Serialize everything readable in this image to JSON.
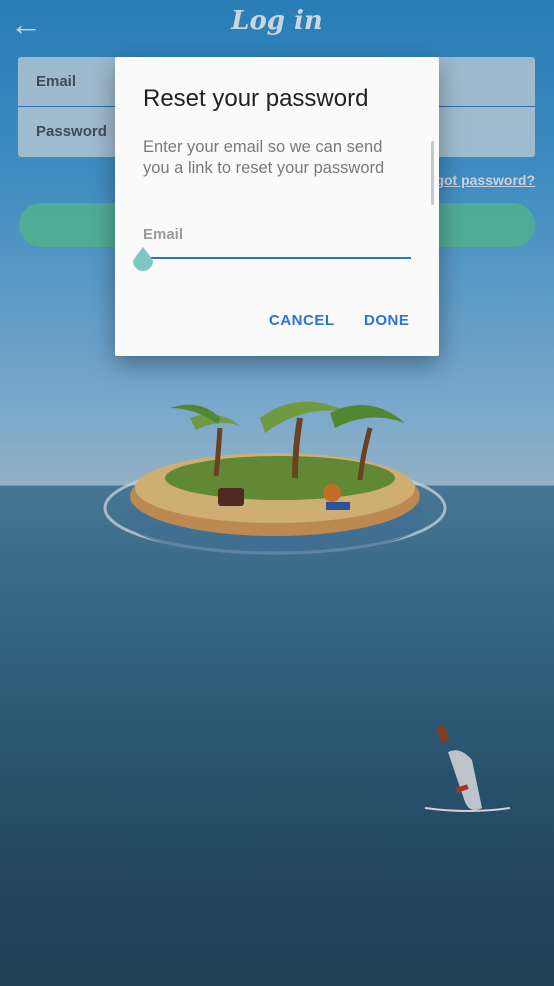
{
  "header": {
    "title": "Log in",
    "back_icon": "arrow-left-icon"
  },
  "form": {
    "email_placeholder": "Email",
    "password_placeholder": "Password",
    "forgot_link": "got password?"
  },
  "dialog": {
    "title": "Reset your password",
    "message": "Enter your email so we can send you a link to reset your password",
    "email_label": "Email",
    "email_value": "",
    "cancel_label": "CANCEL",
    "done_label": "DONE"
  },
  "colors": {
    "accent": "#2e72d2",
    "login_button": "#5ec9a0",
    "handle": "#7cc8c4"
  }
}
